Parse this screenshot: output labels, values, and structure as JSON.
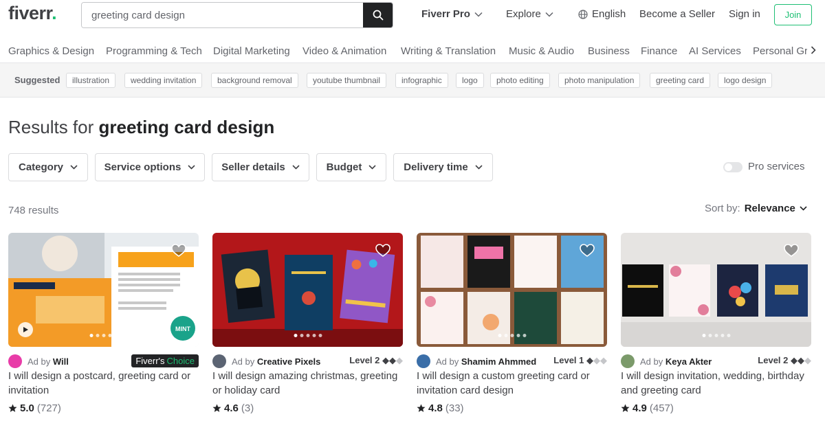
{
  "header": {
    "logo": "fiverr",
    "logo_dot": ".",
    "search_value": "greeting card design",
    "nav": {
      "pro": "Fiverr Pro",
      "explore": "Explore",
      "language": "English",
      "become_seller": "Become a Seller",
      "sign_in": "Sign in",
      "join": "Join"
    }
  },
  "categories": [
    "Graphics & Design",
    "Programming & Tech",
    "Digital Marketing",
    "Video & Animation",
    "Writing & Translation",
    "Music & Audio",
    "Business",
    "Finance",
    "AI Services",
    "Personal Gr"
  ],
  "suggested": {
    "label": "Suggested",
    "chips": [
      "illustration",
      "wedding invitation",
      "background removal",
      "youtube thumbnail",
      "infographic",
      "logo",
      "photo editing",
      "photo manipulation",
      "greeting card",
      "logo design"
    ]
  },
  "results": {
    "prefix": "Results for",
    "query": "greeting card design",
    "count": "748 results",
    "sort_label": "Sort by:",
    "sort_value": "Relevance"
  },
  "filters": [
    "Category",
    "Service options",
    "Seller details",
    "Budget",
    "Delivery time"
  ],
  "pro_services": "Pro services",
  "gigs": [
    {
      "ad": "Ad by",
      "seller": "Will",
      "badge": "Fiverr's",
      "badge_choice": "Choice",
      "title": "I will design a postcard, greeting card or invitation",
      "rating": "5.0",
      "reviews": "(727)"
    },
    {
      "ad": "Ad by",
      "seller": "Creative Pixels",
      "level": "Level 2",
      "title": "I will design amazing christmas, greeting or holiday card",
      "rating": "4.6",
      "reviews": "(3)"
    },
    {
      "ad": "Ad by",
      "seller": "Shamim Ahmmed",
      "level": "Level 1",
      "title": "I will design a custom greeting card or invitation card design",
      "rating": "4.8",
      "reviews": "(33)"
    },
    {
      "ad": "Ad by",
      "seller": "Keya Akter",
      "level": "Level 2",
      "title": "I will design invitation, wedding, birthday and greeting card",
      "rating": "4.9",
      "reviews": "(457)"
    }
  ],
  "colors": {
    "brand_green": "#1dbf73",
    "text_dark": "#404145",
    "text_muted": "#74767e"
  }
}
